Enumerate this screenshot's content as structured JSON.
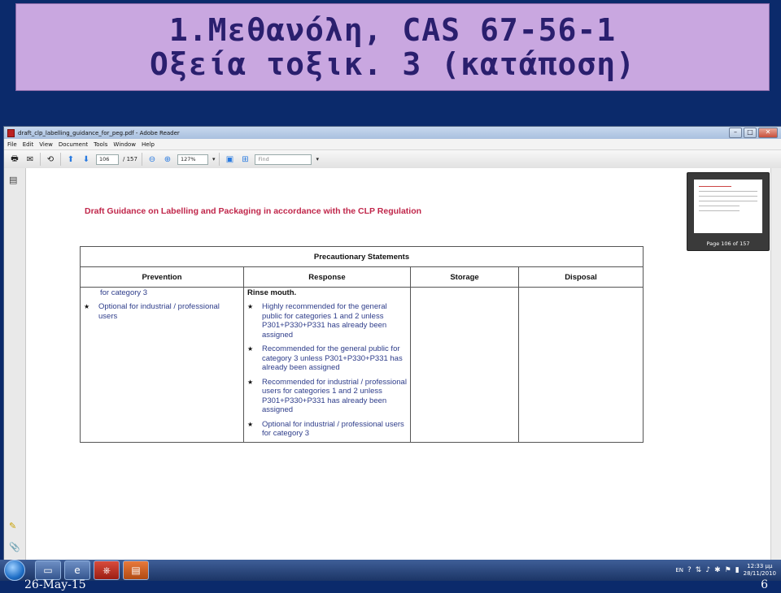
{
  "slide": {
    "title_line1": "1.Μεθανόλη, CAS 67-56-1",
    "title_line2": "Οξεία τοξικ. 3 (κατάποση)",
    "date": "26-May-15",
    "page_number": "6"
  },
  "window": {
    "title": "draft_clp_labelling_guidance_for_peg.pdf - Adobe Reader",
    "controls": {
      "minimize": "–",
      "maximize": "□",
      "close": "✕"
    }
  },
  "menu": [
    "File",
    "Edit",
    "View",
    "Document",
    "Tools",
    "Window",
    "Help"
  ],
  "toolbar": {
    "page_current": "106",
    "page_total": "/ 157",
    "zoom": "127%",
    "find_placeholder": "Find"
  },
  "document": {
    "heading": "Draft Guidance on Labelling and Packaging in accordance with the CLP Regulation",
    "table": {
      "title": "Precautionary Statements",
      "columns": [
        "Prevention",
        "Response",
        "Storage",
        "Disposal"
      ],
      "prevention_first_line": "for category 3",
      "prevention_bullets": [
        "Optional for industrial / professional users"
      ],
      "response_heading": "Rinse mouth.",
      "response_bullets": [
        "Highly recommended for the general public for categories 1 and 2 unless P301+P330+P331 has already been assigned",
        "Recommended for the general public for category 3 unless P301+P330+P331 has already been assigned",
        "Recommended for industrial / professional users for categories 1 and 2 unless P301+P330+P331 has already been assigned",
        "Optional for industrial / professional users for category 3"
      ],
      "bullet_symbol": "★"
    }
  },
  "thumbnail": {
    "label": "Page 106 of 157"
  },
  "taskbar": {
    "language": "EN",
    "time": "12:33 μμ",
    "date": "28/11/2010"
  },
  "icons": {
    "start": "windows-start-icon",
    "explorer": "folder-icon",
    "ie": "internet-explorer-icon",
    "reader": "adobe-reader-icon",
    "ppt": "powerpoint-icon"
  }
}
